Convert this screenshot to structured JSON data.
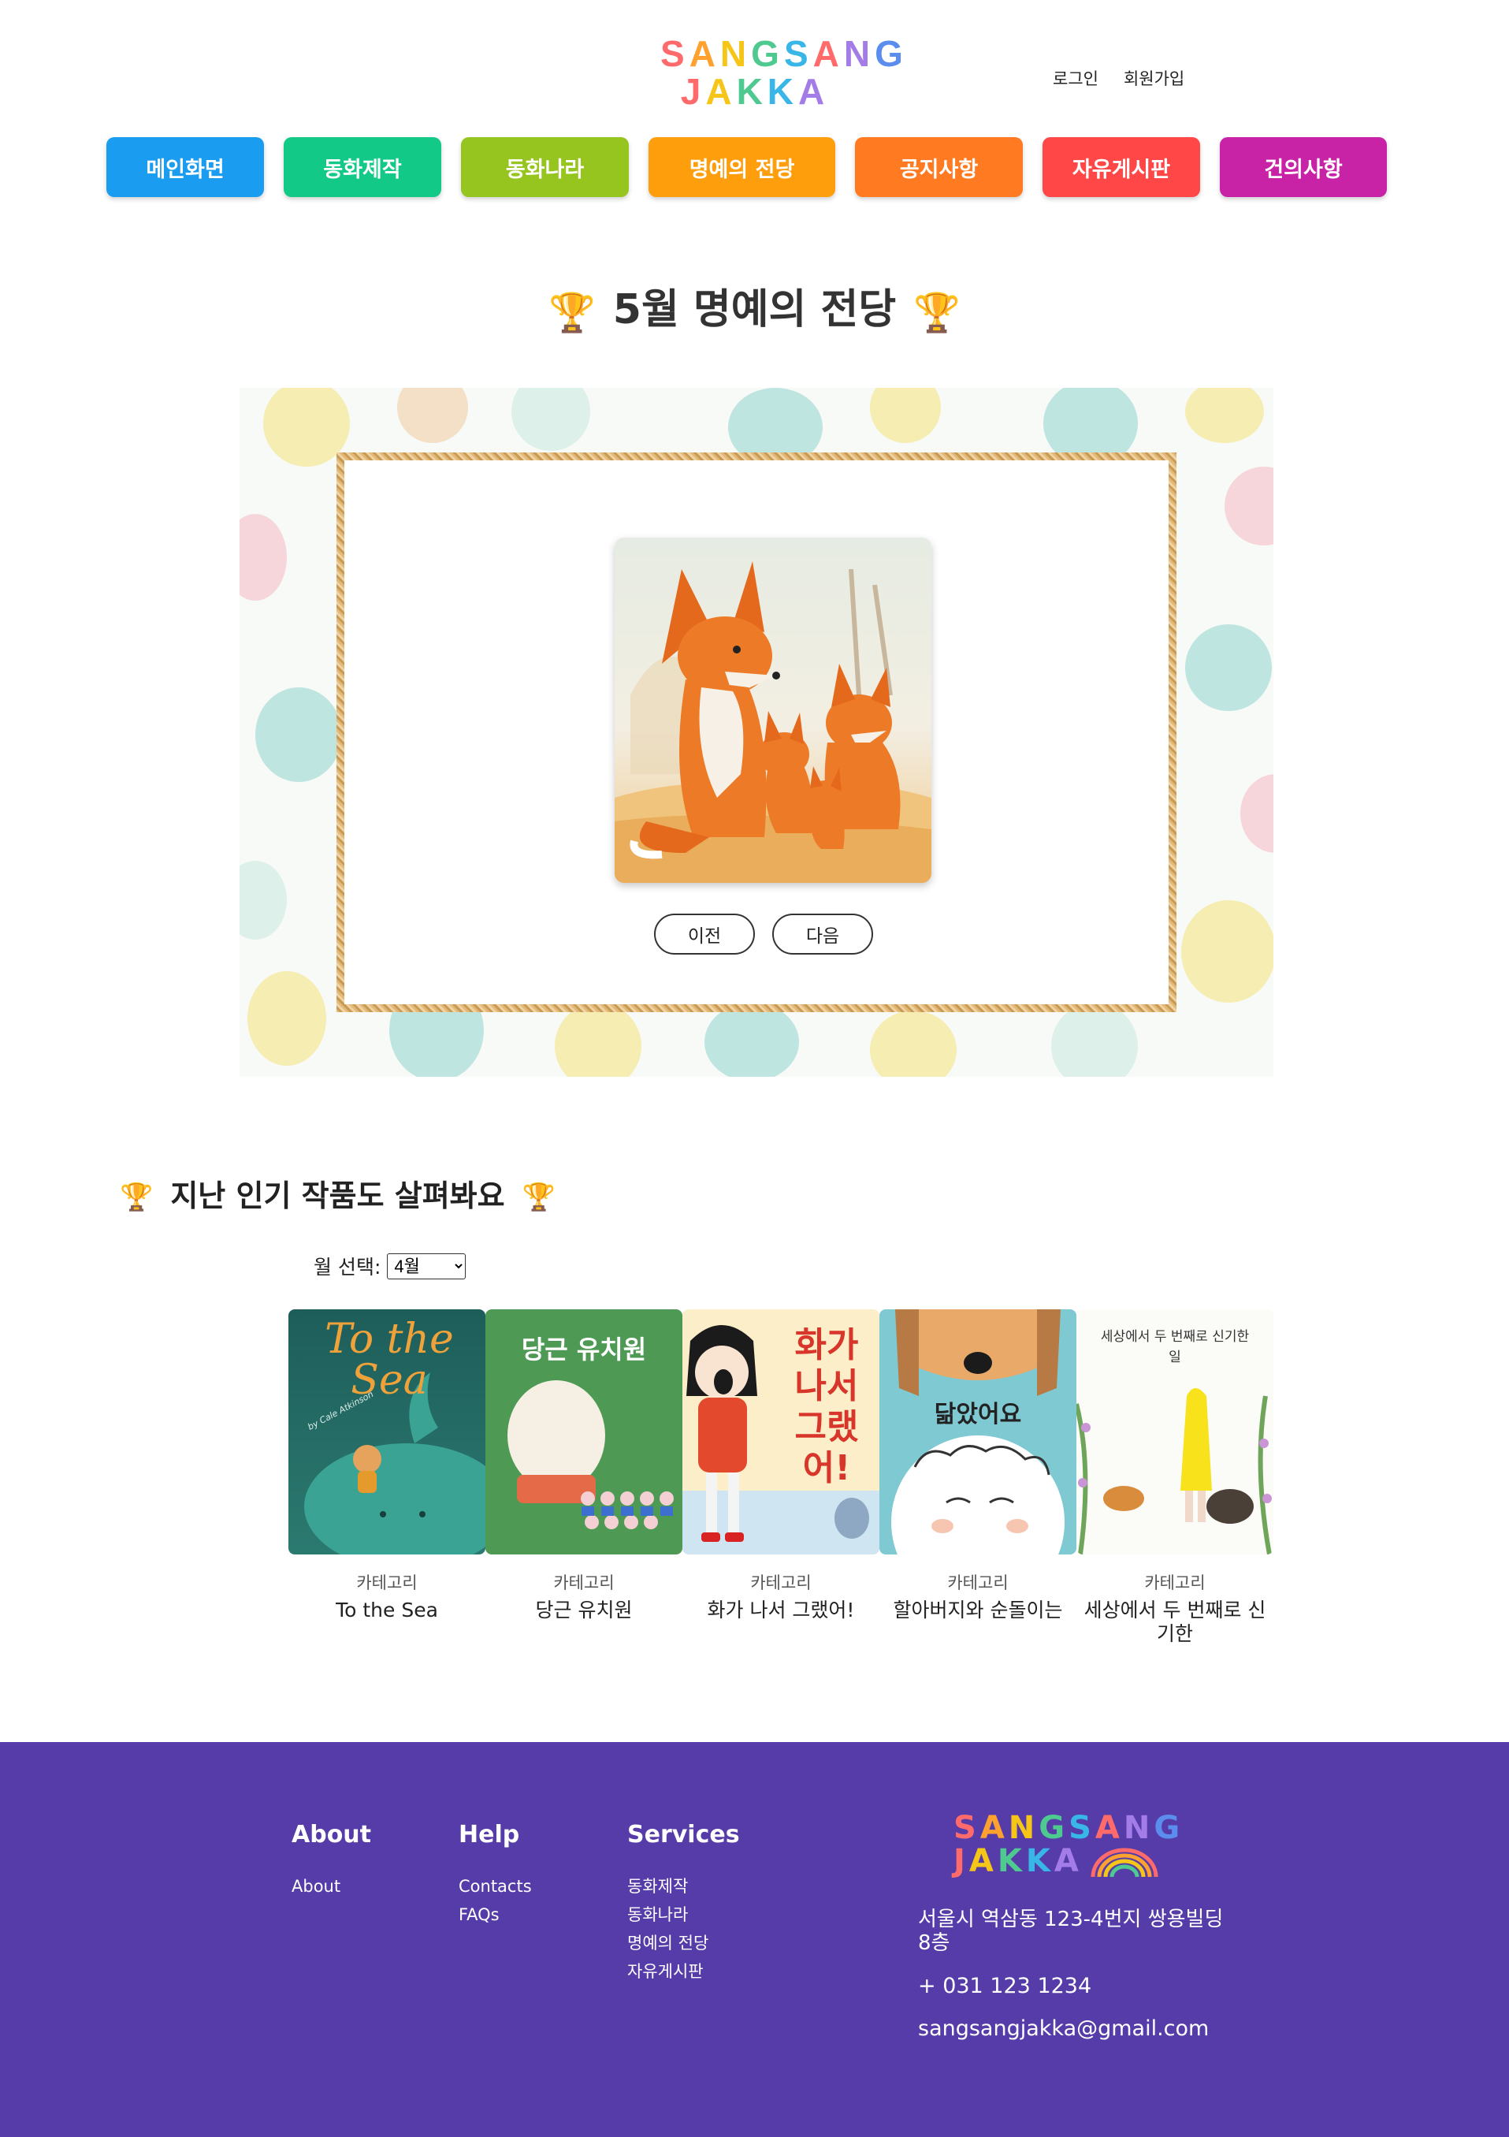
{
  "header": {
    "logo_line1": "SANGSANG",
    "logo_line2": "JAKKA",
    "login": "로그인",
    "signup": "회원가입"
  },
  "nav": [
    {
      "label": "메인화면",
      "color": "#1a9cf0"
    },
    {
      "label": "동화제작",
      "color": "#12c987"
    },
    {
      "label": "동화나라",
      "color": "#97c51f"
    },
    {
      "label": "명예의 전당",
      "color": "#ff9e0d"
    },
    {
      "label": "공지사항",
      "color": "#ff7a21"
    },
    {
      "label": "자유게시판",
      "color": "#ff4747"
    },
    {
      "label": "건의사항",
      "color": "#c822a7"
    }
  ],
  "hall_of_fame": {
    "title": "5월 명예의 전당",
    "trophy": "🏆",
    "prev": "이전",
    "next": "다음"
  },
  "past_works": {
    "title": "지난 인기 작품도 살펴봐요",
    "month_label": "월 선택:",
    "month_selected": "4월",
    "books": [
      {
        "category": "카테고리",
        "title": "To the Sea"
      },
      {
        "category": "카테고리",
        "title": "당근 유치원"
      },
      {
        "category": "카테고리",
        "title": "화가 나서 그랬어!"
      },
      {
        "category": "카테고리",
        "title": "할아버지와 순돌이는"
      },
      {
        "category": "카테고리",
        "title": "세상에서 두 번째로 신기한"
      }
    ],
    "cover_texts": {
      "sea_title": "To the Sea",
      "sea_author": "by Cale Atkinson",
      "carrot_title": "당근 유치원",
      "angry_title": "화가 나서 그랬어!",
      "grandpa_title": "닮았어요",
      "world_title": "세상에서 두 번째로 신기한 일"
    }
  },
  "footer": {
    "about_heading": "About",
    "about_links": [
      "About"
    ],
    "help_heading": "Help",
    "help_links": [
      "Contacts",
      "FAQs"
    ],
    "services_heading": "Services",
    "services_links": [
      "동화제작",
      "동화나라",
      "명예의 전당",
      "자유게시판"
    ],
    "logo_line1": "SANGSANG",
    "logo_line2": "JAKKA",
    "address": "서울시 역삼동 123-4번지 쌍용빌딩 8층",
    "phone": "+ 031 123 1234",
    "email": "sangsangjakka@gmail.com"
  }
}
